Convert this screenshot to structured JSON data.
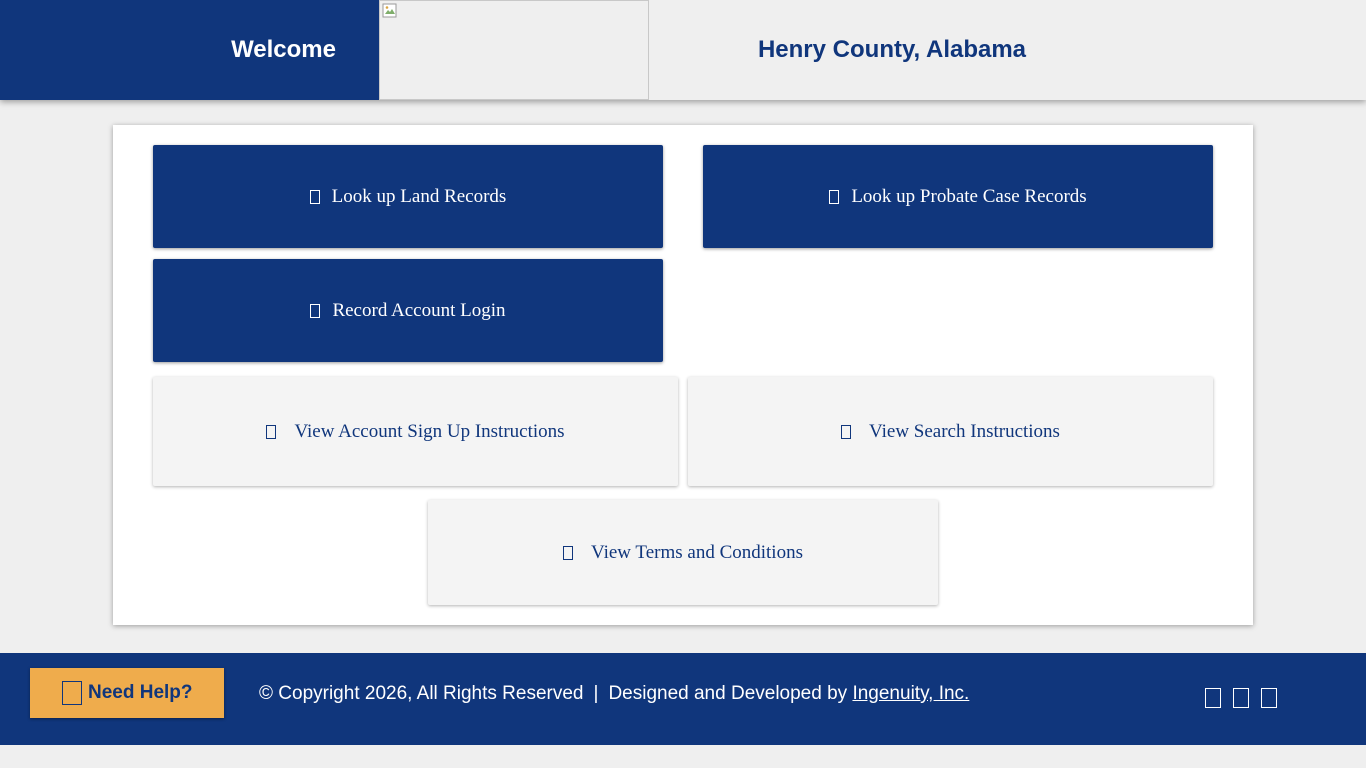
{
  "header": {
    "welcome": "Welcome",
    "county_title": "Henry County, Alabama",
    "logo": "broken-image-icon"
  },
  "main": {
    "buttons": [
      {
        "label": "Look up Land Records",
        "icon": "land-records-icon",
        "style": "primary"
      },
      {
        "label": "Look up Probate Case Records",
        "icon": "probate-records-icon",
        "style": "primary"
      },
      {
        "label": "Record Account Login",
        "icon": "login-icon",
        "style": "primary"
      },
      {
        "label": "View Account Sign Up Instructions",
        "icon": "signup-instructions-icon",
        "style": "secondary"
      },
      {
        "label": "View Search Instructions",
        "icon": "search-instructions-icon",
        "style": "secondary"
      },
      {
        "label": "View Terms and Conditions",
        "icon": "terms-icon",
        "style": "secondary"
      }
    ]
  },
  "footer": {
    "help_label": "Need Help?",
    "copyright": "© Copyright 2026, All Rights Reserved",
    "separator": "|",
    "designed_by": "Designed and Developed by",
    "company_link": "Ingenuity, Inc.",
    "social_icons": [
      "social-icon-1",
      "social-icon-2",
      "social-icon-3"
    ]
  },
  "colors": {
    "brand_blue": "#10367c",
    "help_orange": "#efac4c",
    "background": "#efefef",
    "secondary_button": "#f4f4f4"
  }
}
